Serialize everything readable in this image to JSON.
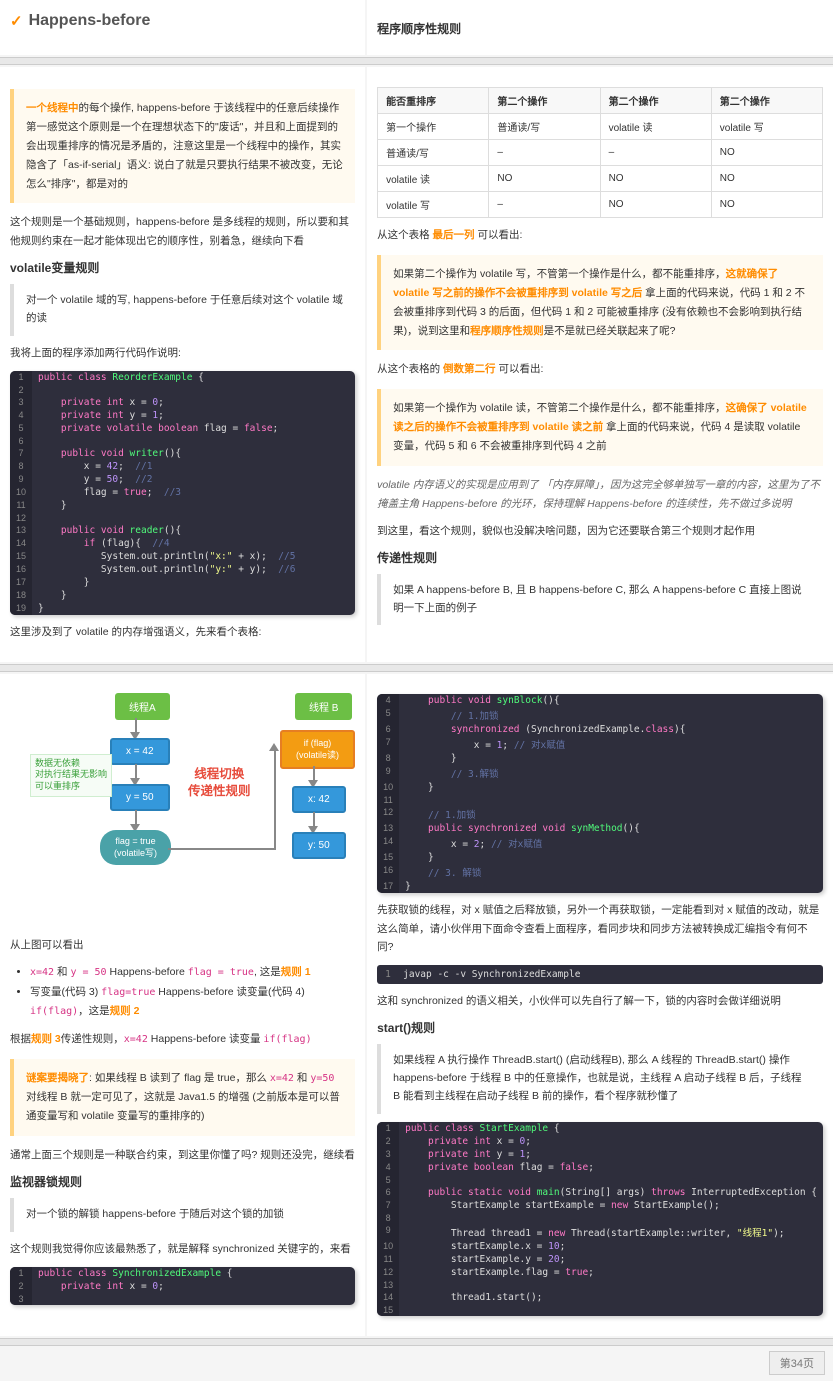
{
  "header": {
    "check": "✓",
    "title": "Happens-before"
  },
  "rightTop": {
    "title": "程序顺序性规则"
  },
  "q1": {
    "pre": "一个线程中",
    "body": "的每个操作, happens-before 于该线程中的任意后续操作 第一感觉这个原则是一个在理想状态下的\"废话\"，并且和上面提到的会出现重排序的情况是矛盾的，注意这里是一个线程中的操作，其实隐含了「as-if-serial」语义: 说白了就是只要执行结果不被改变，无论怎么\"排序\"，都是对的"
  },
  "p1": "这个规则是一个基础规则，happens-before 是多线程的规则，所以要和其他规则约束在一起才能体现出它的顺序性，别着急，继续向下看",
  "h2a": "volatile变量规则",
  "q2": "对一个 volatile 域的写, happens-before 于任意后续对这个 volatile 域的读",
  "p2": "我将上面的程序添加两行代码作说明:",
  "code1": [
    {
      "n": "1",
      "h": "<span class='kw'>public class</span> <span class='cls'>ReorderExample</span> {"
    },
    {
      "n": "2",
      "h": ""
    },
    {
      "n": "3",
      "h": "    <span class='kw'>private int</span> x = <span class='num2'>0</span>;"
    },
    {
      "n": "4",
      "h": "    <span class='kw'>private int</span> y = <span class='num2'>1</span>;"
    },
    {
      "n": "5",
      "h": "    <span class='kw'>private volatile boolean</span> flag = <span class='kw'>false</span>;"
    },
    {
      "n": "6",
      "h": ""
    },
    {
      "n": "7",
      "h": "    <span class='kw'>public void</span> <span class='cls'>writer</span>(){"
    },
    {
      "n": "8",
      "h": "        x = <span class='num2'>42</span>;  <span class='cmt'>//1</span>"
    },
    {
      "n": "9",
      "h": "        y = <span class='num2'>50</span>;  <span class='cmt'>//2</span>"
    },
    {
      "n": "10",
      "h": "        flag = <span class='kw'>true</span>;  <span class='cmt'>//3</span>"
    },
    {
      "n": "11",
      "h": "    }"
    },
    {
      "n": "12",
      "h": ""
    },
    {
      "n": "13",
      "h": "    <span class='kw'>public void</span> <span class='cls'>reader</span>(){"
    },
    {
      "n": "14",
      "h": "        <span class='kw'>if</span> (flag){  <span class='cmt'>//4</span>"
    },
    {
      "n": "15",
      "h": "           System.out.println(<span class='str'>\"x:\"</span> + x);  <span class='cmt'>//5</span>"
    },
    {
      "n": "16",
      "h": "           System.out.println(<span class='str'>\"y:\"</span> + y);  <span class='cmt'>//6</span>"
    },
    {
      "n": "17",
      "h": "        }"
    },
    {
      "n": "18",
      "h": "    }"
    },
    {
      "n": "19",
      "h": "}"
    }
  ],
  "p3": "这里涉及到了 volatile 的内存增强语义，先来看个表格:",
  "table": {
    "head": [
      "能否重排序",
      "第二个操作",
      "第二个操作",
      "第二个操作"
    ],
    "rows": [
      [
        "第一个操作",
        "普通读/写",
        "volatile 读",
        "volatile 写"
      ],
      [
        "普通读/写",
        "–",
        "–",
        "NO"
      ],
      [
        "volatile 读",
        "NO",
        "NO",
        "NO"
      ],
      [
        "volatile 写",
        "–",
        "NO",
        "NO"
      ]
    ]
  },
  "p4": {
    "a": "从这个表格 ",
    "b": "最后一列",
    "c": " 可以看出:"
  },
  "q3": {
    "a": "如果第二个操作为 volatile 写，不管第一个操作是什么，都不能重排序，",
    "b": "这就确保了 volatile 写之前的操作不会被重排序到 volatile 写之后",
    "c": " 拿上面的代码来说，代码 1 和 2 不会被重排序到代码 3 的后面，但代码 1 和 2 可能被重排序 (没有依赖也不会影响到执行结果)，说到这里和",
    "d": "程序顺序性规则",
    "e": "是不是就已经关联起来了呢?"
  },
  "p5": {
    "a": "从这个表格的 ",
    "b": "倒数第二行",
    "c": " 可以看出:"
  },
  "q4": {
    "a": "如果第一个操作为 volatile 读，不管第二个操作是什么，都不能重排序，",
    "b": "这确保了 volatile 读之后的操作不会被重排序到 volatile 读之前",
    "c": " 拿上面的代码来说，代码 4 是读取 volatile 变量，代码 5 和 6 不会被重排序到代码 4 之前"
  },
  "p6": "volatile 内存语义的实现是应用到了 「内存屏障」，因为这完全够单独写一章的内容，这里为了不掩盖主角 Happens-before 的光环，保持理解 Happens-before 的连续性，先不做过多说明",
  "p7": "到这里，看这个规则，貌似也没解决啥问题，因为它还要联合第三个规则才起作用",
  "h2b": "传递性规则",
  "q5": "如果 A happens-before B, 且 B happens-before C, 那么 A happens-before C 直接上图说明一下上面的例子",
  "diagram": {
    "threadA": "线程A",
    "threadB": "线程 B",
    "x42": "x = 42",
    "y50": "y = 50",
    "flagT": "flag = true\n(volatile写)",
    "ifFlag": "if (flag)\n(volatile读)",
    "rx": "x: 42",
    "ry": "y: 50",
    "note": "数据无依赖\n对执行结果无影响\n可以重排序",
    "title": "线程切换\n传递性规则"
  },
  "p8": "从上图可以看出",
  "li1": {
    "a": "x=42",
    "b": " 和 ",
    "c": "y = 50",
    "d": " Happens-before ",
    "e": "flag = true",
    "f": ", 这是",
    "g": "规则 1"
  },
  "li2": {
    "a": "写变量(代码 3) ",
    "b": "flag=true",
    "c": " Happens-before 读变量(代码 4) ",
    "d": "if(flag)",
    "e": "，这是",
    "f": "规则 2"
  },
  "p9": {
    "a": "根据",
    "b": "规则 3",
    "c": "传递性规则，",
    "d": "x=42",
    "e": " Happens-before 读变量 ",
    "f": "if(flag)"
  },
  "q6": {
    "a": "谜案要揭晓了",
    "b": ": 如果线程 B 读到了 flag 是 true，那么 ",
    "c": "x=42",
    "d": " 和 ",
    "e": "y=50",
    "f": " 对线程 B 就一定可见了，这就是 Java1.5 的增强 (之前版本是可以普通变量写和 volatile 变量写的重排序的)"
  },
  "p10": "通常上面三个规则是一种联合约束，到这里你懂了吗? 规则还没完，继续看",
  "h2c": "监视器锁规则",
  "q7": "对一个锁的解锁 happens-before 于随后对这个锁的加锁",
  "p11": "这个规则我觉得你应该最熟悉了，就是解释 synchronized 关键字的，来看",
  "code2": [
    {
      "n": "1",
      "h": "<span class='kw'>public class</span> <span class='cls'>SynchronizedExample</span> {"
    },
    {
      "n": "2",
      "h": "    <span class='kw'>private int</span> x = <span class='num2'>0</span>;"
    },
    {
      "n": "3",
      "h": ""
    }
  ],
  "code3": [
    {
      "n": "4",
      "h": "    <span class='kw'>public void</span> <span class='cls'>synBlock</span>(){"
    },
    {
      "n": "5",
      "h": "        <span class='cmt'>// 1.加锁</span>"
    },
    {
      "n": "6",
      "h": "        <span class='kw'>synchronized</span> (SynchronizedExample.<span class='kw'>class</span>){"
    },
    {
      "n": "7",
      "h": "            x = <span class='num2'>1</span>; <span class='cmt'>// 对x赋值</span>"
    },
    {
      "n": "8",
      "h": "        }"
    },
    {
      "n": "9",
      "h": "        <span class='cmt'>// 3.解锁</span>"
    },
    {
      "n": "10",
      "h": "    }"
    },
    {
      "n": "11",
      "h": ""
    },
    {
      "n": "12",
      "h": "    <span class='cmt'>// 1.加锁</span>"
    },
    {
      "n": "13",
      "h": "    <span class='kw'>public synchronized void</span> <span class='cls'>synMethod</span>(){"
    },
    {
      "n": "14",
      "h": "        x = <span class='num2'>2</span>; <span class='cmt'>// 对x赋值</span>"
    },
    {
      "n": "15",
      "h": "    }"
    },
    {
      "n": "16",
      "h": "    <span class='cmt'>// 3. 解锁</span>"
    },
    {
      "n": "17",
      "h": "}"
    }
  ],
  "p12": "先获取锁的线程，对 x 赋值之后释放锁，另外一个再获取锁，一定能看到对 x 赋值的改动，就是这么简单，请小伙伴用下面命令查看上面程序，看同步块和同步方法被转换成汇编指令有何不同?",
  "cmd": "javap -c -v SynchronizedExample",
  "p13": "这和 synchronized 的语义相关，小伙伴可以先自行了解一下，锁的内容时会做详细说明",
  "h2d": "start()规则",
  "q8": "如果线程 A 执行操作 ThreadB.start() (启动线程B), 那么 A 线程的 ThreadB.start() 操作 happens-before 于线程 B 中的任意操作，也就是说，主线程 A 启动子线程 B 后，子线程 B 能看到主线程在启动子线程 B 前的操作，看个程序就秒懂了",
  "code4": [
    {
      "n": "1",
      "h": "<span class='kw'>public class</span> <span class='cls'>StartExample</span> {"
    },
    {
      "n": "2",
      "h": "    <span class='kw'>private int</span> x = <span class='num2'>0</span>;"
    },
    {
      "n": "3",
      "h": "    <span class='kw'>private int</span> y = <span class='num2'>1</span>;"
    },
    {
      "n": "4",
      "h": "    <span class='kw'>private boolean</span> flag = <span class='kw'>false</span>;"
    },
    {
      "n": "5",
      "h": ""
    },
    {
      "n": "6",
      "h": "    <span class='kw'>public static void</span> <span class='cls'>main</span>(String[] args) <span class='kw'>throws</span> InterruptedException {"
    },
    {
      "n": "7",
      "h": "        StartExample startExample = <span class='kw'>new</span> StartExample();"
    },
    {
      "n": "8",
      "h": ""
    },
    {
      "n": "9",
      "h": "        Thread thread1 = <span class='kw'>new</span> Thread(startExample::writer, <span class='str'>\"线程1\"</span>);"
    },
    {
      "n": "10",
      "h": "        startExample.x = <span class='num2'>10</span>;"
    },
    {
      "n": "11",
      "h": "        startExample.y = <span class='num2'>20</span>;"
    },
    {
      "n": "12",
      "h": "        startExample.flag = <span class='kw'>true</span>;"
    },
    {
      "n": "13",
      "h": ""
    },
    {
      "n": "14",
      "h": "        thread1.start();"
    },
    {
      "n": "15",
      "h": ""
    }
  ],
  "pagenum": "第34页"
}
